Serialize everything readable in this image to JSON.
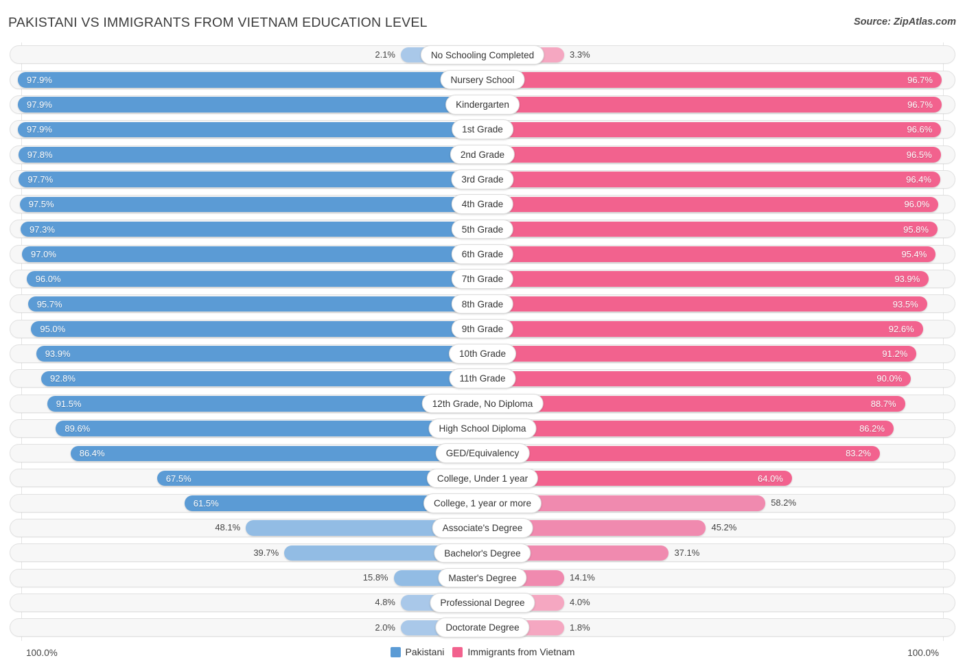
{
  "header": {
    "title": "PAKISTANI VS IMMIGRANTS FROM VIETNAM EDUCATION LEVEL",
    "source": "Source: ZipAtlas.com"
  },
  "footer": {
    "axis_left": "100.0%",
    "axis_right": "100.0%"
  },
  "legend": [
    {
      "label": "Pakistani",
      "color": "#5b9bd5"
    },
    {
      "label": "Immigrants from Vietnam",
      "color": "#f2628e"
    }
  ],
  "colors": {
    "blue_strong": "#5b9bd5",
    "blue_light": "#92bce4",
    "blue_lighter": "#a9c8e9",
    "pink_strong": "#f2628e",
    "pink_light": "#f08aaf",
    "pink_lighter": "#f5a7c1",
    "track_bg": "#f7f7f7",
    "track_border": "#e0e0e0",
    "value_text_outside": "#444444",
    "value_text_inside": "#ffffff"
  },
  "chart_data": {
    "type": "bar",
    "title": "PAKISTANI VS IMMIGRANTS FROM VIETNAM EDUCATION LEVEL",
    "subtitle": "",
    "xlabel": "",
    "ylabel": "",
    "orientation": "horizontal-diverging",
    "grid": false,
    "legend_position": "bottom-center",
    "xlim": [
      0,
      100
    ],
    "axis_max_label": "100.0%",
    "categories": [
      "No Schooling Completed",
      "Nursery School",
      "Kindergarten",
      "1st Grade",
      "2nd Grade",
      "3rd Grade",
      "4th Grade",
      "5th Grade",
      "6th Grade",
      "7th Grade",
      "8th Grade",
      "9th Grade",
      "10th Grade",
      "11th Grade",
      "12th Grade, No Diploma",
      "High School Diploma",
      "GED/Equivalency",
      "College, Under 1 year",
      "College, 1 year or more",
      "Associate's Degree",
      "Bachelor's Degree",
      "Master's Degree",
      "Professional Degree",
      "Doctorate Degree"
    ],
    "series": [
      {
        "name": "Pakistani",
        "color": "#5b9bd5",
        "side": "left",
        "values": [
          2.1,
          97.9,
          97.9,
          97.9,
          97.8,
          97.7,
          97.5,
          97.3,
          97.0,
          96.0,
          95.7,
          95.0,
          93.9,
          92.8,
          91.5,
          89.6,
          86.4,
          67.5,
          61.5,
          48.1,
          39.7,
          15.8,
          4.8,
          2.0
        ],
        "labels": [
          "2.1%",
          "97.9%",
          "97.9%",
          "97.9%",
          "97.8%",
          "97.7%",
          "97.5%",
          "97.3%",
          "97.0%",
          "96.0%",
          "95.7%",
          "95.0%",
          "93.9%",
          "92.8%",
          "91.5%",
          "89.6%",
          "86.4%",
          "67.5%",
          "61.5%",
          "48.1%",
          "39.7%",
          "15.8%",
          "4.8%",
          "2.0%"
        ]
      },
      {
        "name": "Immigrants from Vietnam",
        "color": "#f2628e",
        "side": "right",
        "values": [
          3.3,
          96.7,
          96.7,
          96.6,
          96.5,
          96.4,
          96.0,
          95.8,
          95.4,
          93.9,
          93.5,
          92.6,
          91.2,
          90.0,
          88.7,
          86.2,
          83.2,
          64.0,
          58.2,
          45.2,
          37.1,
          14.1,
          4.0,
          1.8
        ],
        "labels": [
          "3.3%",
          "96.7%",
          "96.7%",
          "96.6%",
          "96.5%",
          "96.4%",
          "96.0%",
          "95.8%",
          "95.4%",
          "93.9%",
          "93.5%",
          "92.6%",
          "91.2%",
          "90.0%",
          "88.7%",
          "86.2%",
          "83.2%",
          "64.0%",
          "58.2%",
          "45.2%",
          "37.1%",
          "14.1%",
          "4.0%",
          "1.8%"
        ]
      }
    ]
  }
}
